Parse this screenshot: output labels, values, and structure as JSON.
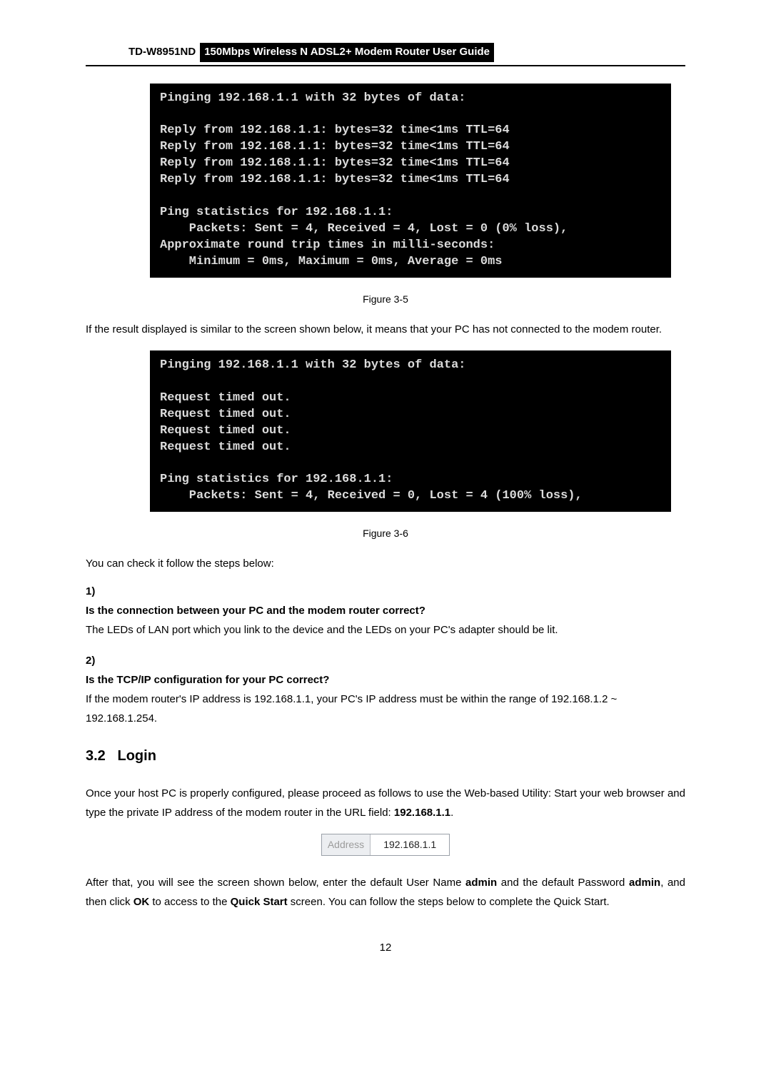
{
  "header": {
    "model": "TD-W8951ND",
    "title": "150Mbps Wireless N ADSL2+ Modem Router User Guide"
  },
  "console1": "Pinging 192.168.1.1 with 32 bytes of data:\n\nReply from 192.168.1.1: bytes=32 time<1ms TTL=64\nReply from 192.168.1.1: bytes=32 time<1ms TTL=64\nReply from 192.168.1.1: bytes=32 time<1ms TTL=64\nReply from 192.168.1.1: bytes=32 time<1ms TTL=64\n\nPing statistics for 192.168.1.1:\n    Packets: Sent = 4, Received = 4, Lost = 0 (0% loss),\nApproximate round trip times in milli-seconds:\n    Minimum = 0ms, Maximum = 0ms, Average = 0ms",
  "figure1_caption": "Figure 3-5",
  "para1": "If the result displayed is similar to the screen shown below, it means that your PC has not connected to the modem router.",
  "console2": "Pinging 192.168.1.1 with 32 bytes of data:\n\nRequest timed out.\nRequest timed out.\nRequest timed out.\nRequest timed out.\n\nPing statistics for 192.168.1.1:\n    Packets: Sent = 4, Received = 0, Lost = 4 (100% loss),",
  "figure2_caption": "Figure 3-6",
  "para2": "You can check it follow the steps below:",
  "steps": {
    "s1": {
      "num": "1)",
      "q": "Is the connection between your PC and the modem router correct?",
      "a": "The LEDs of LAN port which you link to the device and the LEDs on your PC's adapter should be lit."
    },
    "s2": {
      "num": "2)",
      "q": "Is the TCP/IP configuration for your PC correct?",
      "a": "If the modem router's IP address is 192.168.1.1, your PC's IP address must be within the range of 192.168.1.2 ~ 192.168.1.254."
    }
  },
  "section": {
    "num": "3.2",
    "title": "Login"
  },
  "para3_a": "Once your host PC is properly configured, please proceed as follows to use the Web-based Utility: Start your web browser and type the private IP address of the modem router in the URL field: ",
  "para3_ip": "192.168.1.1",
  "para3_b": ".",
  "address_box": {
    "label": "Address",
    "value": "192.168.1.1"
  },
  "para4_a": "After that, you will see the screen shown below, enter the default User Name ",
  "para4_b": " and the default Password ",
  "para4_c": ", and then click ",
  "para4_d": " to access to the ",
  "para4_e": " screen. You can follow the steps below to complete the Quick Start.",
  "bold": {
    "admin1": "admin",
    "admin2": "admin",
    "ok": "OK",
    "quickstart": "Quick Start"
  },
  "page_number": "12"
}
